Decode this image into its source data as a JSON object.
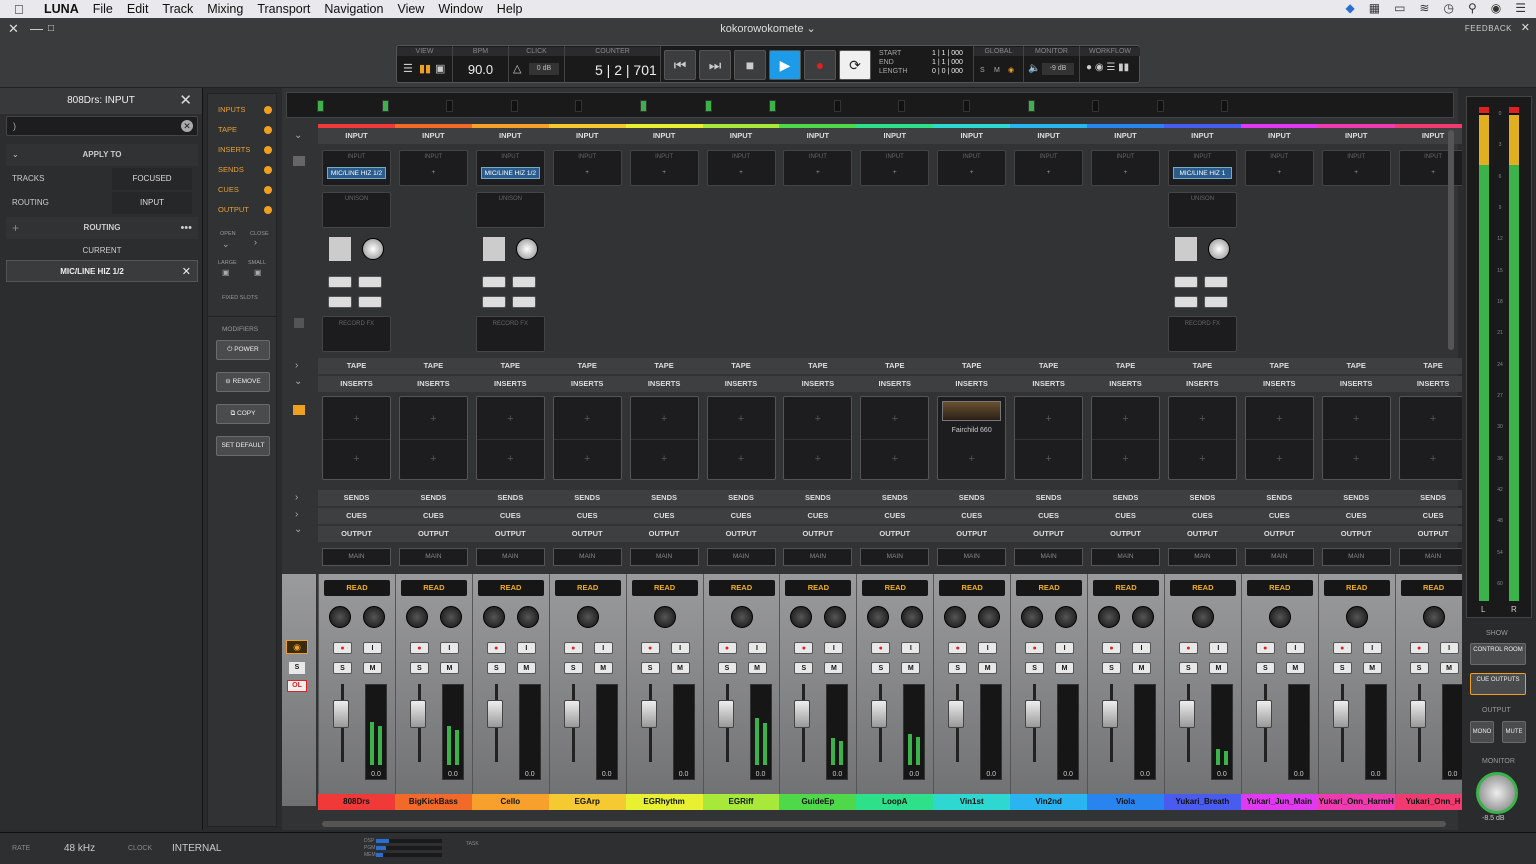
{
  "menubar": {
    "app": "LUNA",
    "items": [
      "File",
      "Edit",
      "Track",
      "Mixing",
      "Transport",
      "Navigation",
      "View",
      "Window",
      "Help"
    ]
  },
  "window": {
    "title": "kokorowokomete ⌄",
    "feedback": "FEEDBACK"
  },
  "transport": {
    "view_label": "VIEW",
    "bpm_label": "BPM",
    "bpm": "90.0",
    "click_label": "CLICK",
    "click_db": "0 dB",
    "counter_label": "COUNTER",
    "counter": "5 | 2 | 701",
    "start_label": "START",
    "end_label": "END",
    "length_label": "LENGTH",
    "start": "1 | 1 | 000",
    "end": "1 | 1 | 000",
    "length": "0 | 0 | 000",
    "global_label": "GLOBAL",
    "global_s": "S",
    "global_m": "M",
    "monitor_label": "MONITOR",
    "monitor_db": "-9 dB",
    "workflow_label": "WORKFLOW"
  },
  "left_panel": {
    "title": "808Drs: INPUT",
    "search_value": ")",
    "apply_to": "APPLY TO",
    "tracks_label": "TRACKS",
    "tracks_value": "FOCUSED",
    "routing_label": "ROUTING",
    "routing_value": "INPUT",
    "routing_header": "ROUTING",
    "current_label": "CURRENT",
    "current_value": "MIC/LINE HIZ 1/2"
  },
  "strip": {
    "items": [
      "INPUTS",
      "TAPE",
      "INSERTS",
      "SENDS",
      "CUES",
      "OUTPUT"
    ],
    "open": "OPEN",
    "close": "CLOSE",
    "large": "LARGE",
    "small": "SMALL",
    "fixed_slots": "FIXED SLOTS",
    "modifiers": "MODIFIERS",
    "power": "POWER",
    "remove": "REMOVE",
    "copy": "COPY",
    "set_default": "SET DEFAULT"
  },
  "sections": {
    "input": "INPUT",
    "tape": "TAPE",
    "inserts": "INSERTS",
    "sends": "SENDS",
    "cues": "CUES",
    "output": "OUTPUT",
    "main": "MAIN",
    "read": "READ",
    "unison": "UNISON",
    "record_fx": "RECORD FX"
  },
  "channels": [
    {
      "name": "808Drs",
      "color": "#f03a3a",
      "input": "MIC/LINE HIZ 1/2",
      "stereo": true,
      "fx": true,
      "level": "0.0",
      "meter": 0.55
    },
    {
      "name": "BigKickBass",
      "color": "#f26a2a",
      "input": "",
      "stereo": true,
      "fx": false,
      "level": "0.0",
      "meter": 0.5
    },
    {
      "name": "Cello",
      "color": "#f7a02c",
      "input": "MIC/LINE HIZ 1/2",
      "stereo": true,
      "fx": true,
      "level": "0.0",
      "meter": 0
    },
    {
      "name": "EGArp",
      "color": "#f5c932",
      "input": "",
      "stereo": false,
      "fx": false,
      "level": "0.0",
      "meter": 0
    },
    {
      "name": "EGRhythm",
      "color": "#e8f032",
      "input": "",
      "stereo": false,
      "fx": false,
      "level": "0.0",
      "meter": 0
    },
    {
      "name": "EGRiff",
      "color": "#a8e83a",
      "input": "",
      "stereo": false,
      "fx": false,
      "level": "0.0",
      "meter": 0.6
    },
    {
      "name": "GuideEp",
      "color": "#4ed84a",
      "input": "",
      "stereo": true,
      "fx": false,
      "level": "0.0",
      "meter": 0.35
    },
    {
      "name": "LoopA",
      "color": "#2ee08a",
      "input": "",
      "stereo": true,
      "fx": false,
      "level": "0.0",
      "meter": 0.4
    },
    {
      "name": "Vin1st",
      "color": "#2ed8d0",
      "input": "",
      "stereo": true,
      "fx": false,
      "level": "0.0",
      "meter": 0,
      "plugin": "Fairchild 660"
    },
    {
      "name": "Vin2nd",
      "color": "#2ab4f0",
      "input": "",
      "stereo": true,
      "fx": false,
      "level": "0.0",
      "meter": 0
    },
    {
      "name": "Viola",
      "color": "#2a84f0",
      "input": "",
      "stereo": true,
      "fx": false,
      "level": "0.0",
      "meter": 0
    },
    {
      "name": "Yukari_Breath",
      "color": "#4a5cf0",
      "input": "MIC/LINE HIZ 1",
      "stereo": false,
      "fx": true,
      "level": "0.0",
      "meter": 0.2
    },
    {
      "name": "Yukari_Jun_Main",
      "color": "#e03af0",
      "input": "",
      "stereo": false,
      "fx": false,
      "level": "0.0",
      "meter": 0
    },
    {
      "name": "Yukari_Onn_HarmH",
      "color": "#f03ab0",
      "input": "",
      "stereo": false,
      "fx": false,
      "level": "0.0",
      "meter": 0
    },
    {
      "name": "Yukari_Onn_H",
      "color": "#f03a70",
      "input": "",
      "stereo": false,
      "fx": false,
      "level": "0.0",
      "meter": 0
    }
  ],
  "master": {
    "scale": [
      "0",
      "3",
      "6",
      "9",
      "12",
      "15",
      "18",
      "21",
      "24",
      "27",
      "30",
      "36",
      "42",
      "48",
      "54",
      "60"
    ],
    "left": "L",
    "right": "R",
    "show": "SHOW",
    "control_room": "CONTROL ROOM",
    "cue_outputs": "CUE OUTPUTS",
    "output": "OUTPUT",
    "mono": "MONO",
    "mute": "MUTE",
    "monitor": "MONITOR",
    "monitor_value": "-8.5 dB"
  },
  "bottom": {
    "rate_label": "RATE",
    "rate": "48 kHz",
    "clock_label": "CLOCK",
    "clock": "INTERNAL",
    "dsp_label": "DSP",
    "pgm_label": "PGM",
    "mem_label": "MEM",
    "task_label": "TASK"
  }
}
